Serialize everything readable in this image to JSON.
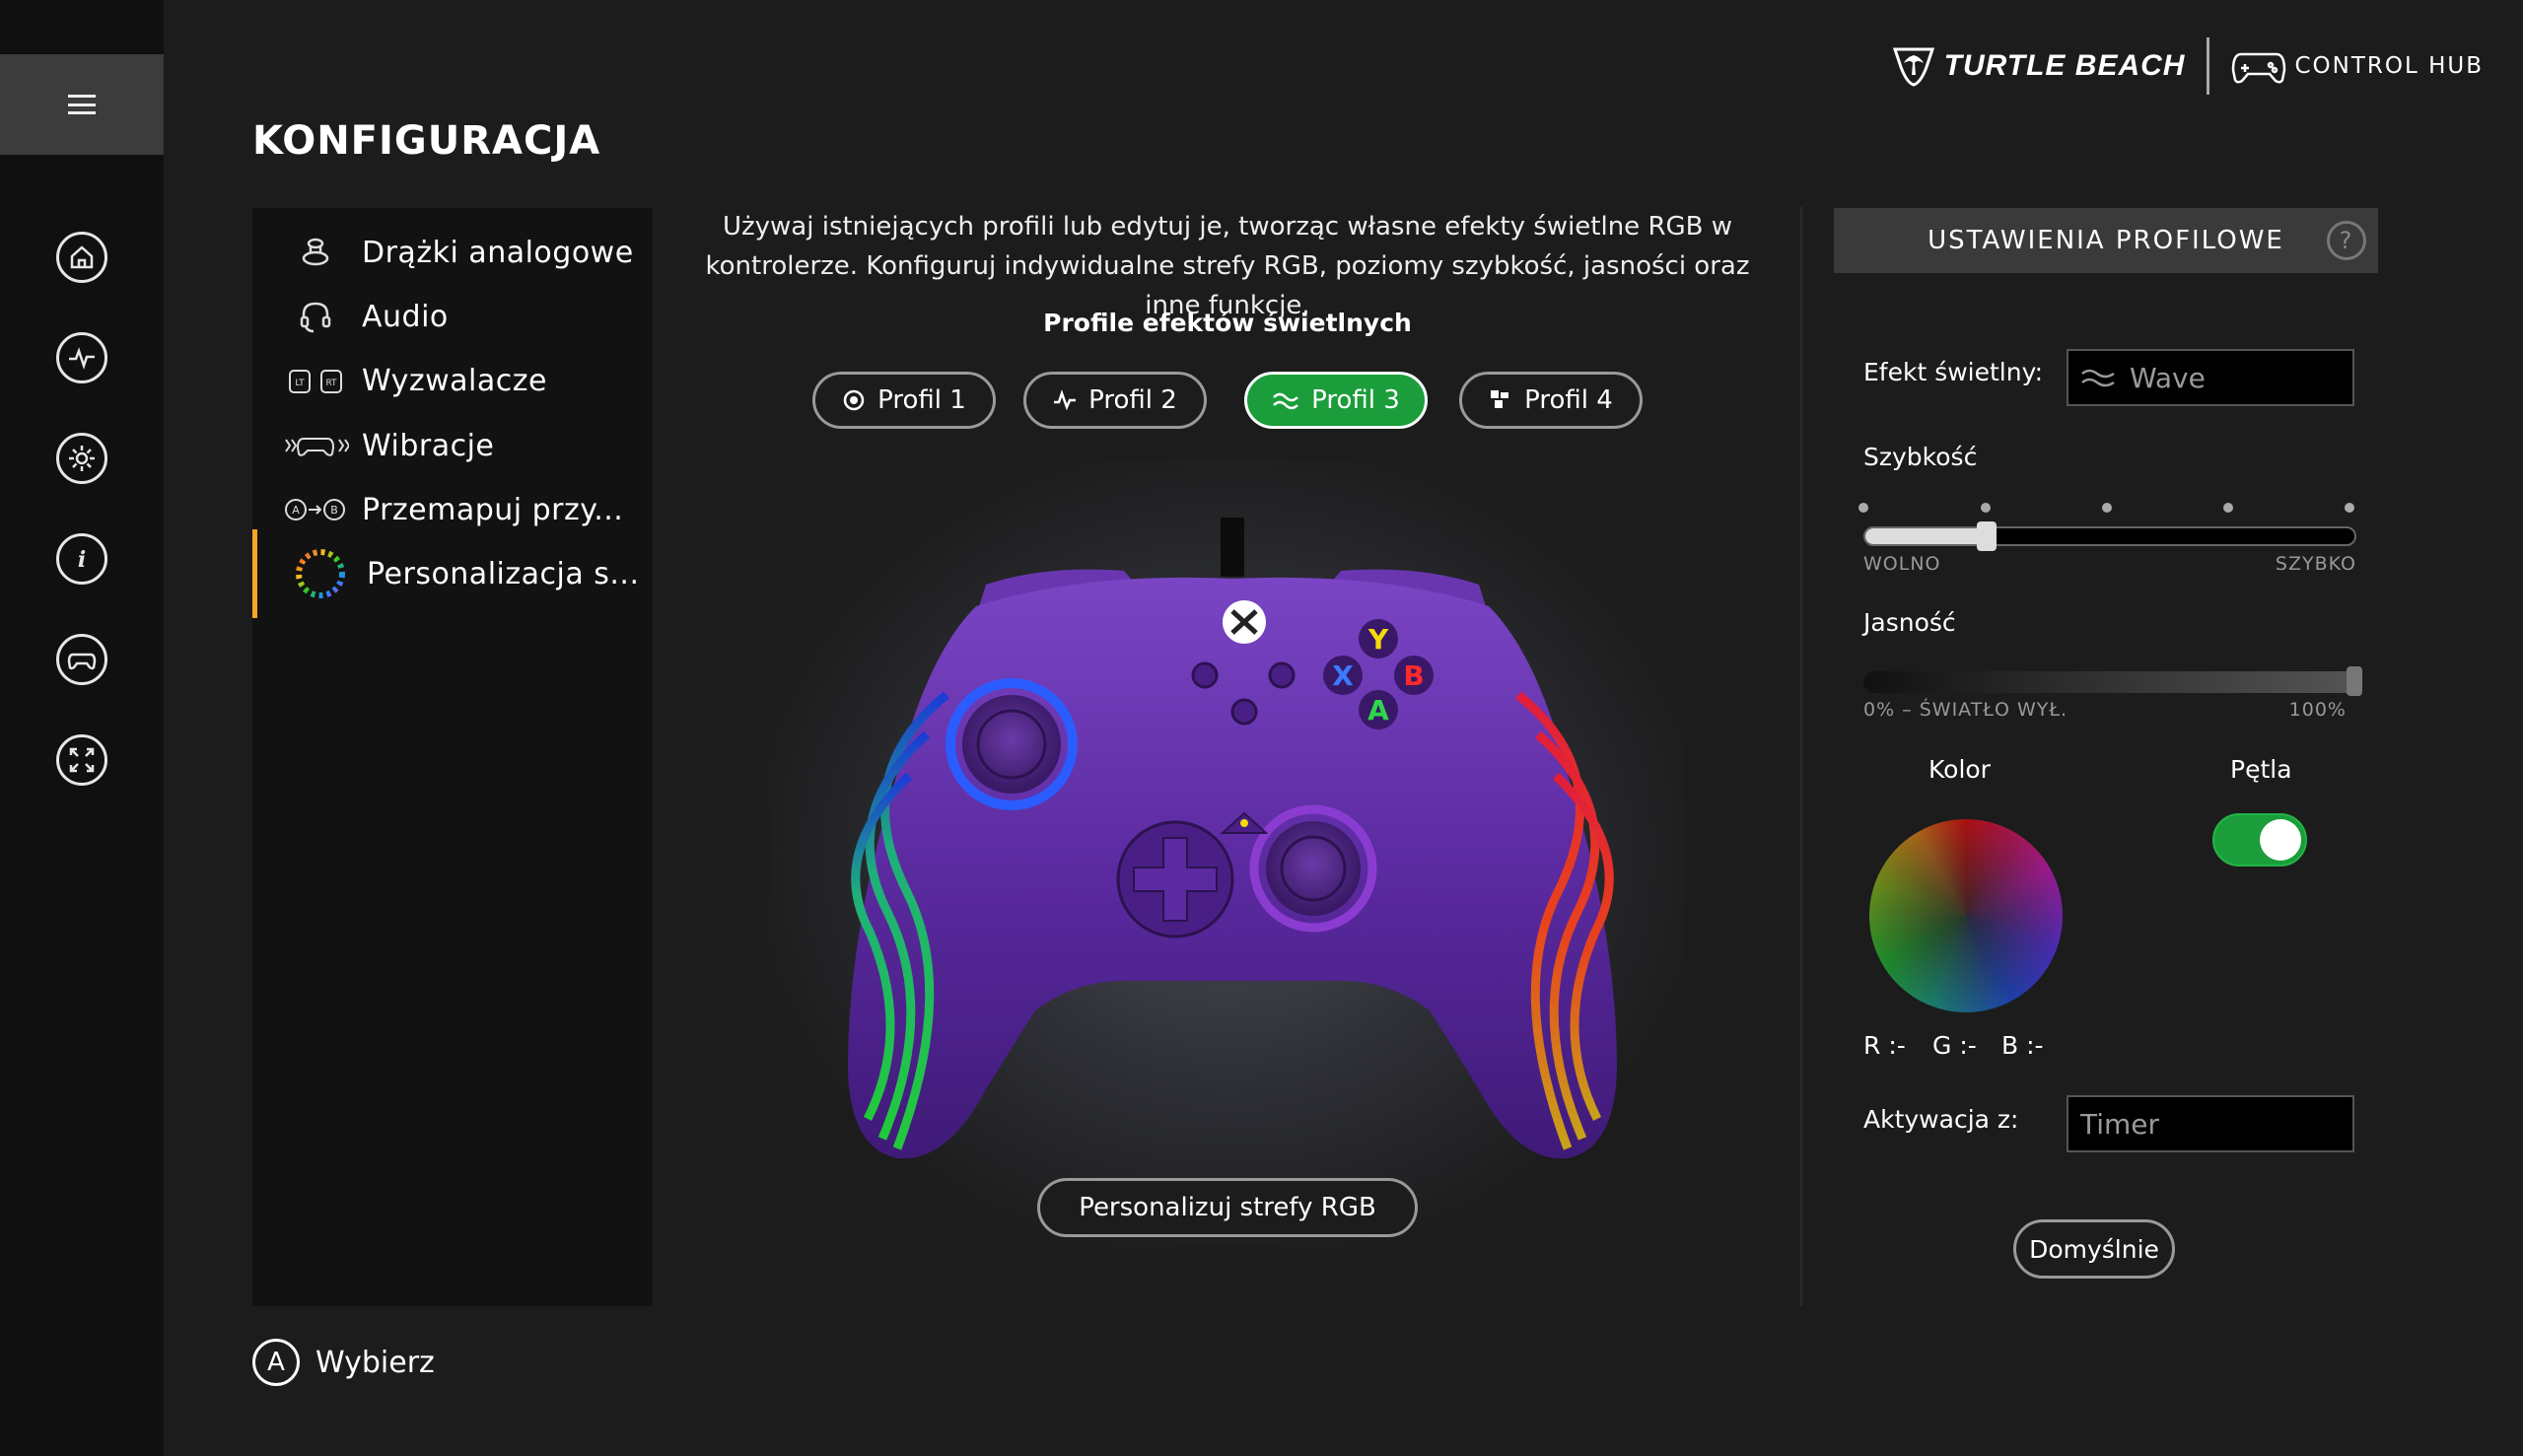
{
  "brand": {
    "name": "TURTLE BEACH",
    "product": "CONTROL HUB"
  },
  "page_title": "KONFIGURACJA",
  "rail": {
    "icons": [
      "menu-icon",
      "home-icon",
      "pulse-icon",
      "gear-icon",
      "info-icon",
      "controller-icon",
      "fullscreen-icon"
    ]
  },
  "nav": {
    "items": [
      {
        "label": "Drążki analogowe",
        "icon": "thumbstick-icon"
      },
      {
        "label": "Audio",
        "icon": "headset-icon"
      },
      {
        "label": "Wyzwalacze",
        "icon": "triggers-icon"
      },
      {
        "label": "Wibracje",
        "icon": "vibration-icon"
      },
      {
        "label": "Przemapuj przy...",
        "icon": "remap-icon"
      },
      {
        "label": "Personalizacja s...",
        "icon": "rgb-ring-icon",
        "active": true
      }
    ]
  },
  "hint": {
    "button": "A",
    "label": "Wybierz"
  },
  "center": {
    "description": "Używaj istniejących profili lub edytuj je, tworząc własne efekty świetlne RGB w kontrolerze. Konfiguruj indywidualne strefy RGB, poziomy szybkość, jasności oraz inne funkcje.",
    "profiles_title": "Profile efektów świetlnych",
    "profiles": [
      {
        "label": "Profil 1",
        "icon": "target-icon"
      },
      {
        "label": "Profil 2",
        "icon": "pulse-icon"
      },
      {
        "label": "Profil 3",
        "icon": "wave-icon",
        "selected": true
      },
      {
        "label": "Profil 4",
        "icon": "blocks-icon"
      }
    ],
    "personalize_button": "Personalizuj strefy RGB",
    "controller_buttons": {
      "y": "Y",
      "x": "X",
      "b": "B",
      "a": "A"
    }
  },
  "right_panel": {
    "header": "USTAWIENIA PROFILOWE",
    "help": "?",
    "effect_label": "Efekt świetlny:",
    "effect_value": "Wave",
    "speed_label": "Szybkość",
    "speed_min": "WOLNO",
    "speed_max": "SZYBKO",
    "speed_level": 0.25,
    "brightness_label": "Jasność",
    "brightness_min": "0% – ŚWIATŁO WYŁ.",
    "brightness_max": "100%",
    "brightness_level": 1.0,
    "color_label": "Kolor",
    "loop_label": "Pętla",
    "loop_on": true,
    "rgb_r": "R :-",
    "rgb_g": "G :-",
    "rgb_b": "B :-",
    "activation_label": "Aktywacja z:",
    "activation_value": "Timer",
    "default_button": "Domyślnie"
  },
  "colors": {
    "accent_green": "#1a9d3a",
    "active_marker": "#f5a623",
    "controller_purple": "#5b2aa0"
  }
}
